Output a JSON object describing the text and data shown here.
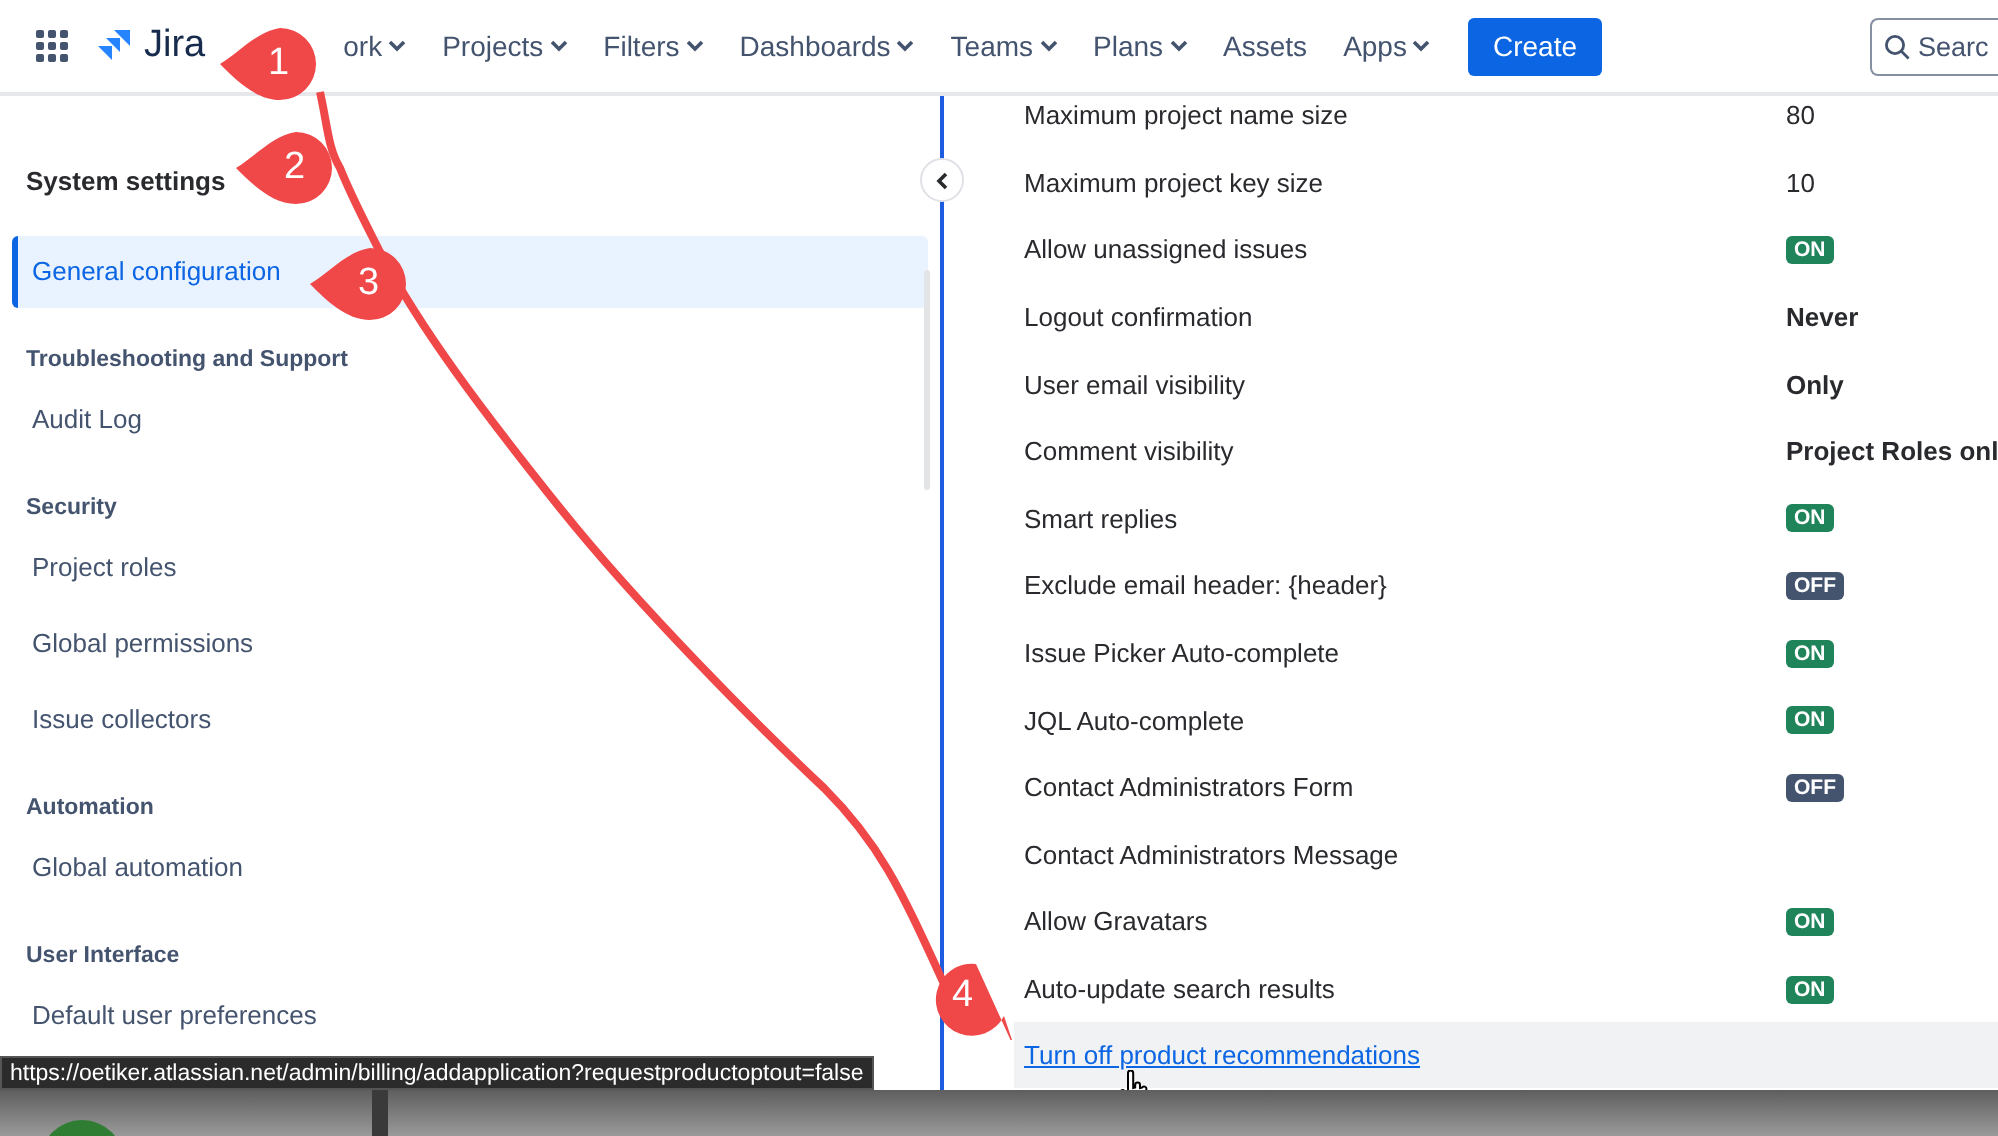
{
  "topbar": {
    "logo": "Jira",
    "nav": [
      {
        "label": "ork",
        "dropdown": true
      },
      {
        "label": "Projects",
        "dropdown": true
      },
      {
        "label": "Filters",
        "dropdown": true
      },
      {
        "label": "Dashboards",
        "dropdown": true
      },
      {
        "label": "Teams",
        "dropdown": true
      },
      {
        "label": "Plans",
        "dropdown": true
      },
      {
        "label": "Assets",
        "dropdown": false
      },
      {
        "label": "Apps",
        "dropdown": true
      }
    ],
    "create": "Create",
    "search": {
      "placeholder": "Searc"
    }
  },
  "sidebar": {
    "title": "System settings",
    "sections": [
      {
        "items": [
          {
            "label": "General configuration",
            "selected": true
          }
        ]
      },
      {
        "heading": "Troubleshooting and Support",
        "items": [
          {
            "label": "Audit Log",
            "selected": false
          }
        ]
      },
      {
        "heading": "Security",
        "items": [
          {
            "label": "Project roles",
            "selected": false
          },
          {
            "label": "Global permissions",
            "selected": false
          },
          {
            "label": "Issue collectors",
            "selected": false
          }
        ]
      },
      {
        "heading": "Automation",
        "items": [
          {
            "label": "Global automation",
            "selected": false
          }
        ]
      },
      {
        "heading": "User Interface",
        "items": [
          {
            "label": "Default user preferences",
            "selected": false
          }
        ]
      }
    ]
  },
  "settings": [
    {
      "label": "Maximum project name size",
      "kind": "text",
      "value": "80"
    },
    {
      "label": "Maximum project key size",
      "kind": "text",
      "value": "10"
    },
    {
      "label": "Allow unassigned issues",
      "kind": "toggle",
      "on": true,
      "value": "ON"
    },
    {
      "label": "Logout confirmation",
      "kind": "bold",
      "value": "Never"
    },
    {
      "label": "User email visibility",
      "kind": "bold",
      "value": "Only"
    },
    {
      "label": "Comment visibility",
      "kind": "bold",
      "value": "Project Roles onl"
    },
    {
      "label": "Smart replies",
      "kind": "toggle",
      "on": true,
      "value": "ON"
    },
    {
      "label": "Exclude email header: {header}",
      "kind": "toggle",
      "on": false,
      "value": "OFF"
    },
    {
      "label": "Issue Picker Auto-complete",
      "kind": "toggle",
      "on": true,
      "value": "ON"
    },
    {
      "label": "JQL Auto-complete",
      "kind": "toggle",
      "on": true,
      "value": "ON"
    },
    {
      "label": "Contact Administrators Form",
      "kind": "toggle",
      "on": false,
      "value": "OFF"
    },
    {
      "label": "Contact Administrators Message",
      "kind": "empty"
    },
    {
      "label": "Allow Gravatars",
      "kind": "toggle",
      "on": true,
      "value": "ON"
    },
    {
      "label": "Auto-update search results",
      "kind": "toggle",
      "on": true,
      "value": "ON"
    }
  ],
  "link": "Turn off product recommendations",
  "status_url": "https://oetiker.atlassian.net/admin/billing/addapplication?requestproductoptout=false",
  "annotations": [
    "1",
    "2",
    "3",
    "4"
  ]
}
